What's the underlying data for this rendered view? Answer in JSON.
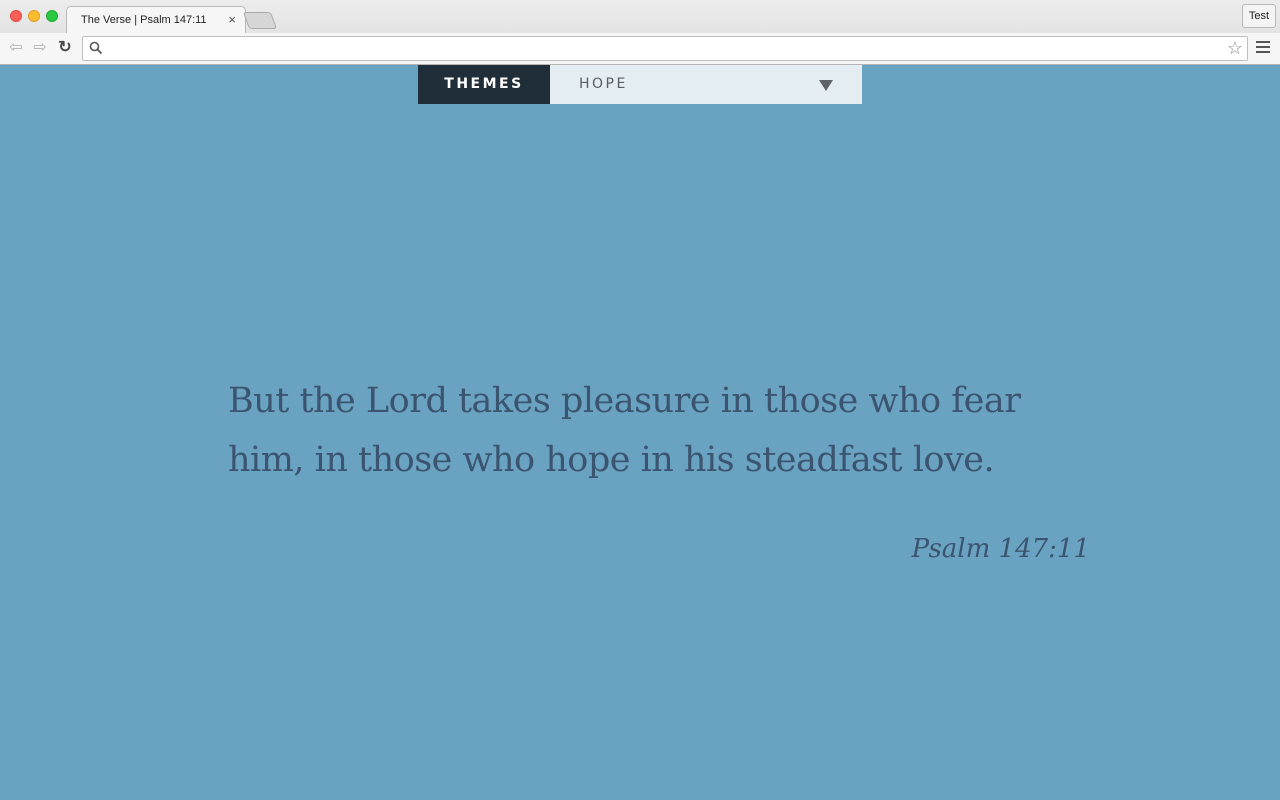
{
  "browser": {
    "tab_title": "The Verse | Psalm 147:11",
    "tab_close": "×",
    "profile_label": "Test",
    "address_value": ""
  },
  "themes": {
    "label": "THEMES",
    "selected": "HOPE"
  },
  "verse": {
    "text": "But the Lord takes pleasure in those who fear him, in those who hope in his steadfast love.",
    "reference": "Psalm 147:11"
  },
  "colors": {
    "background": "#6aa3c1",
    "themes_label_bg": "#1f2e38",
    "theme_select_bg": "#e3edf2",
    "verse_text": "#3b5470"
  },
  "icons": {
    "back": "arrow-left",
    "forward": "arrow-right",
    "reload": "reload",
    "search": "magnifier",
    "bookmark": "star-outline",
    "menu": "hamburger",
    "dropdown": "triangle-down"
  }
}
